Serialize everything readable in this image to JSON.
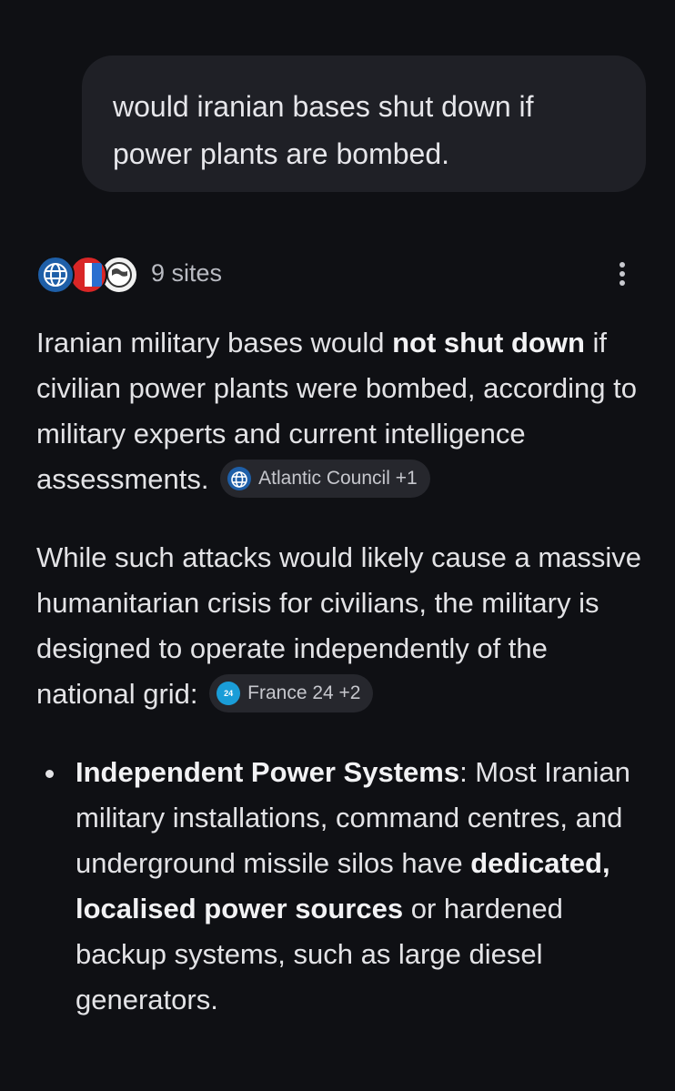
{
  "user_message": {
    "text": "would iranian bases shut down if power plants are bombed."
  },
  "sources": {
    "favicons": [
      "atlantic-council-icon",
      "news-icon",
      "globe-map-icon"
    ],
    "count_label": "9 sites"
  },
  "answer": {
    "p1": {
      "pre": "Iranian military bases would ",
      "bold": "not shut down",
      "post": " if civilian power plants were bombed, according to military experts and current intelligence assessments.",
      "chip": "Atlantic Council +1"
    },
    "p2": {
      "text": "While such attacks would likely cause a massive humanitarian crisis for civilians, the military is designed to operate independently of the national grid:",
      "chip": "France 24 +2",
      "chip_icon_text": "24"
    },
    "bullets": [
      {
        "title": "Independent Power Systems",
        "text1": ": Most Iranian military installations, command centres, and underground missile silos have ",
        "bold": "dedicated, localised power sources",
        "text2": " or hardened backup systems, such as large diesel generators."
      }
    ]
  },
  "colors": {
    "background": "#0f1014",
    "bubble": "#1f2026",
    "chip": "#26272d"
  }
}
